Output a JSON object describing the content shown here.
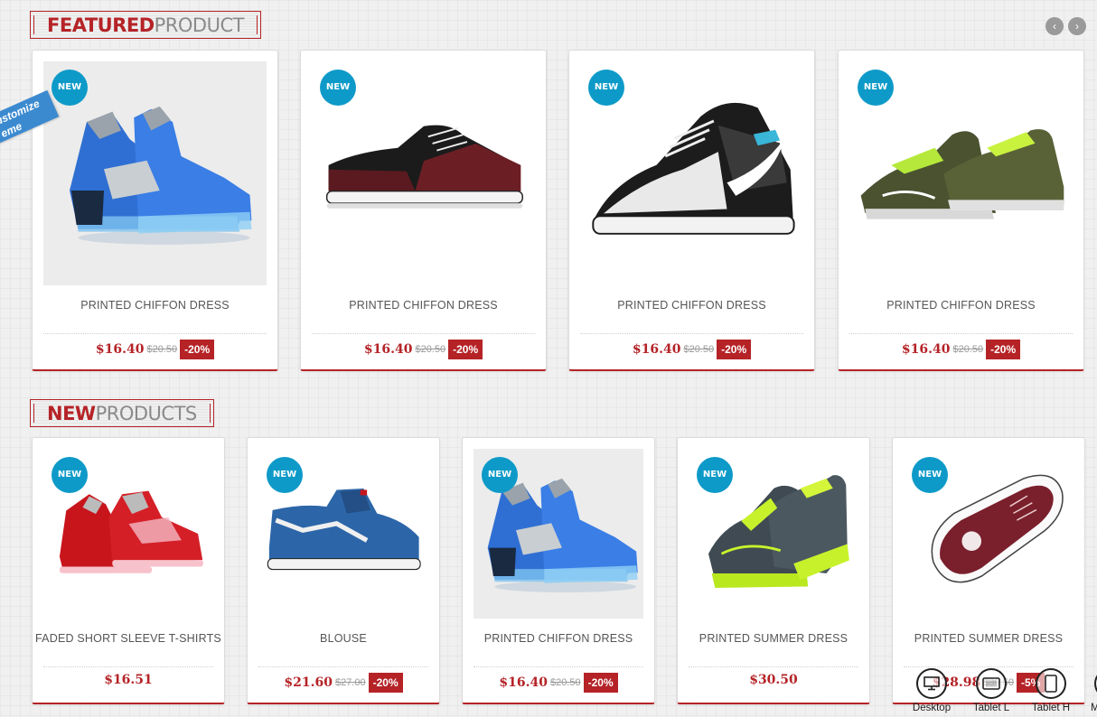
{
  "featured": {
    "title_strong": "FEATURED",
    "title_light": "PRODUCT"
  },
  "new_products": {
    "title_strong": "NEW",
    "title_light": "PRODUCTS"
  },
  "carousel": {
    "prev_label": "‹",
    "next_label": "›"
  },
  "customize_tag": {
    "line1": "ustomize",
    "line2": "eme"
  },
  "colors": {
    "accent": "#b52327",
    "badge": "#0e9ac8"
  },
  "featured_products": [
    {
      "badge": "NEW",
      "name": "PRINTED CHIFFON DRESS",
      "price": "$16.40",
      "old_price": "$20.50",
      "discount": "-20%",
      "image": "blue-high-top-sneaker"
    },
    {
      "badge": "NEW",
      "name": "PRINTED CHIFFON DRESS",
      "price": "$16.40",
      "old_price": "$20.50",
      "discount": "-20%",
      "image": "maroon-black-skate-shoe"
    },
    {
      "badge": "NEW",
      "name": "PRINTED CHIFFON DRESS",
      "price": "$16.40",
      "old_price": "$20.50",
      "discount": "-20%",
      "image": "black-white-nike-shoe"
    },
    {
      "badge": "NEW",
      "name": "PRINTED CHIFFON DRESS",
      "price": "$16.40",
      "old_price": "$20.50",
      "discount": "-20%",
      "image": "green-running-shoes"
    }
  ],
  "new_products_list": [
    {
      "badge": "NEW",
      "name": "FADED SHORT SLEEVE T-SHIRTS",
      "price": "$16.51",
      "old_price": "",
      "discount": "",
      "image": "red-high-top-sneaker"
    },
    {
      "badge": "NEW",
      "name": "BLOUSE",
      "price": "$21.60",
      "old_price": "$27.00",
      "discount": "-20%",
      "image": "blue-vans-high-top"
    },
    {
      "badge": "NEW",
      "name": "PRINTED CHIFFON DRESS",
      "price": "$16.40",
      "old_price": "$20.50",
      "discount": "-20%",
      "image": "blue-high-top-sneaker"
    },
    {
      "badge": "NEW",
      "name": "PRINTED SUMMER DRESS",
      "price": "$30.50",
      "old_price": "",
      "discount": "",
      "image": "lime-dark-running-shoe"
    },
    {
      "badge": "NEW",
      "name": "PRINTED SUMMER DRESS",
      "price": "$28.98",
      "old_price": "$30.50",
      "discount": "-5%",
      "image": "maroon-suede-shoe"
    }
  ],
  "device_switcher": [
    {
      "label": "Desktop",
      "icon": "desktop-icon"
    },
    {
      "label": "Tablet L",
      "icon": "tablet-landscape-icon"
    },
    {
      "label": "Tablet H",
      "icon": "tablet-portrait-icon"
    },
    {
      "label": "M",
      "icon": "mobile-icon"
    }
  ]
}
